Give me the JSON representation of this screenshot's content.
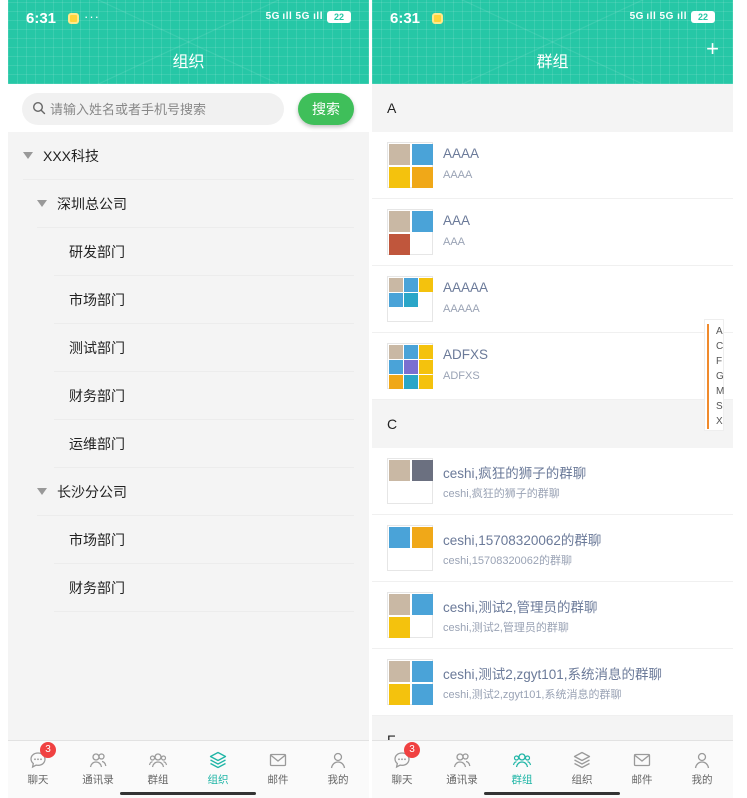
{
  "status_bar": {
    "time": "6:31",
    "more": "···",
    "signal": "5G ıll 5G ıll",
    "battery": "22"
  },
  "left": {
    "title": "组织",
    "search": {
      "placeholder": "请输入姓名或者手机号搜索",
      "button": "搜索"
    },
    "tree": [
      {
        "label": "XXX科技",
        "level": 0,
        "expanded": true
      },
      {
        "label": "深圳总公司",
        "level": 1,
        "expanded": true
      },
      {
        "label": "研发部门",
        "level": 2
      },
      {
        "label": "市场部门",
        "level": 2
      },
      {
        "label": "测试部门",
        "level": 2
      },
      {
        "label": "财务部门",
        "level": 2
      },
      {
        "label": "运维部门",
        "level": 2
      },
      {
        "label": "长沙分公司",
        "level": 1,
        "expanded": true
      },
      {
        "label": "市场部门",
        "level": 2
      },
      {
        "label": "财务部门",
        "level": 2
      }
    ],
    "tabs": [
      {
        "label": "聊天",
        "icon": "chat-icon",
        "badge": "3"
      },
      {
        "label": "通讯录",
        "icon": "contacts-icon"
      },
      {
        "label": "群组",
        "icon": "group-icon"
      },
      {
        "label": "组织",
        "icon": "layers-icon",
        "active": true
      },
      {
        "label": "邮件",
        "icon": "mail-icon"
      },
      {
        "label": "我的",
        "icon": "profile-icon"
      }
    ]
  },
  "right": {
    "title": "群组",
    "add": "+",
    "sections": [
      {
        "letter": "A",
        "groups": [
          {
            "name": "AAAA",
            "sub": "AAAA"
          },
          {
            "name": "AAA",
            "sub": "AAA"
          },
          {
            "name": "AAAAA",
            "sub": "AAAAA"
          },
          {
            "name": "ADFXS",
            "sub": "ADFXS"
          }
        ]
      },
      {
        "letter": "C",
        "groups": [
          {
            "name": "ceshi,疯狂的狮子的群聊",
            "sub": "ceshi,疯狂的狮子的群聊"
          },
          {
            "name": "ceshi,15708320062的群聊",
            "sub": "ceshi,15708320062的群聊"
          },
          {
            "name": "ceshi,测试2,管理员的群聊",
            "sub": "ceshi,测试2,管理员的群聊"
          },
          {
            "name": "ceshi,测试2,zgyt101,系统消息的群聊",
            "sub": "ceshi,测试2,zgyt101,系统消息的群聊"
          }
        ]
      },
      {
        "letter": "F",
        "groups": []
      }
    ],
    "alpha_index": [
      "A",
      "C",
      "F",
      "G",
      "M",
      "S",
      "X"
    ],
    "tabs": [
      {
        "label": "聊天",
        "icon": "chat-icon",
        "badge": "3"
      },
      {
        "label": "通讯录",
        "icon": "contacts-icon"
      },
      {
        "label": "群组",
        "icon": "group-icon",
        "active": true
      },
      {
        "label": "组织",
        "icon": "layers-icon"
      },
      {
        "label": "邮件",
        "icon": "mail-icon"
      },
      {
        "label": "我的",
        "icon": "profile-icon"
      }
    ]
  },
  "colors": {
    "header": "#26c7a6",
    "search_button": "#3fbf5a",
    "active_tab": "#1fb5a6",
    "badge": "#f04141"
  }
}
